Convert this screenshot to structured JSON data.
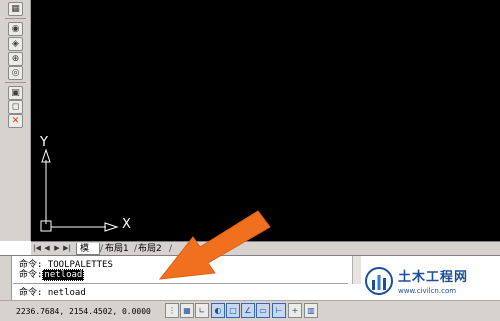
{
  "toolbar": {
    "icons": [
      "view-icon",
      "orbit-icon",
      "pan-icon",
      "zoom-icon",
      "zoom-window-icon",
      "properties-icon",
      "box-icon",
      "delete-icon"
    ]
  },
  "canvas": {
    "background": "#000000",
    "ucs": {
      "x_label": "X",
      "y_label": "Y"
    }
  },
  "tabbar": {
    "tabs": [
      {
        "label": "模型",
        "active": true
      },
      {
        "label": "布局1",
        "active": false
      },
      {
        "label": "布局2",
        "active": false
      }
    ]
  },
  "command": {
    "history": [
      {
        "prompt": "命令:",
        "text": "TOOLPALETTES"
      },
      {
        "prompt": "命令:",
        "text": "netload"
      }
    ],
    "current": {
      "prompt": "命令:",
      "text": "netload"
    }
  },
  "statusbar": {
    "coords": "2236.7684, 2154.4502, 0.0000",
    "buttons": [
      "snap-icon",
      "grid-icon",
      "ortho-icon",
      "polar-icon",
      "osnap-icon",
      "otrack-icon",
      "dyn-icon",
      "lineweight-icon",
      "model-icon"
    ]
  },
  "annotation": {
    "arrow_color": "#f07020"
  },
  "watermark": {
    "title": "土木工程网",
    "url": "www.civilcn.com",
    "color": "#1b4f9c"
  }
}
